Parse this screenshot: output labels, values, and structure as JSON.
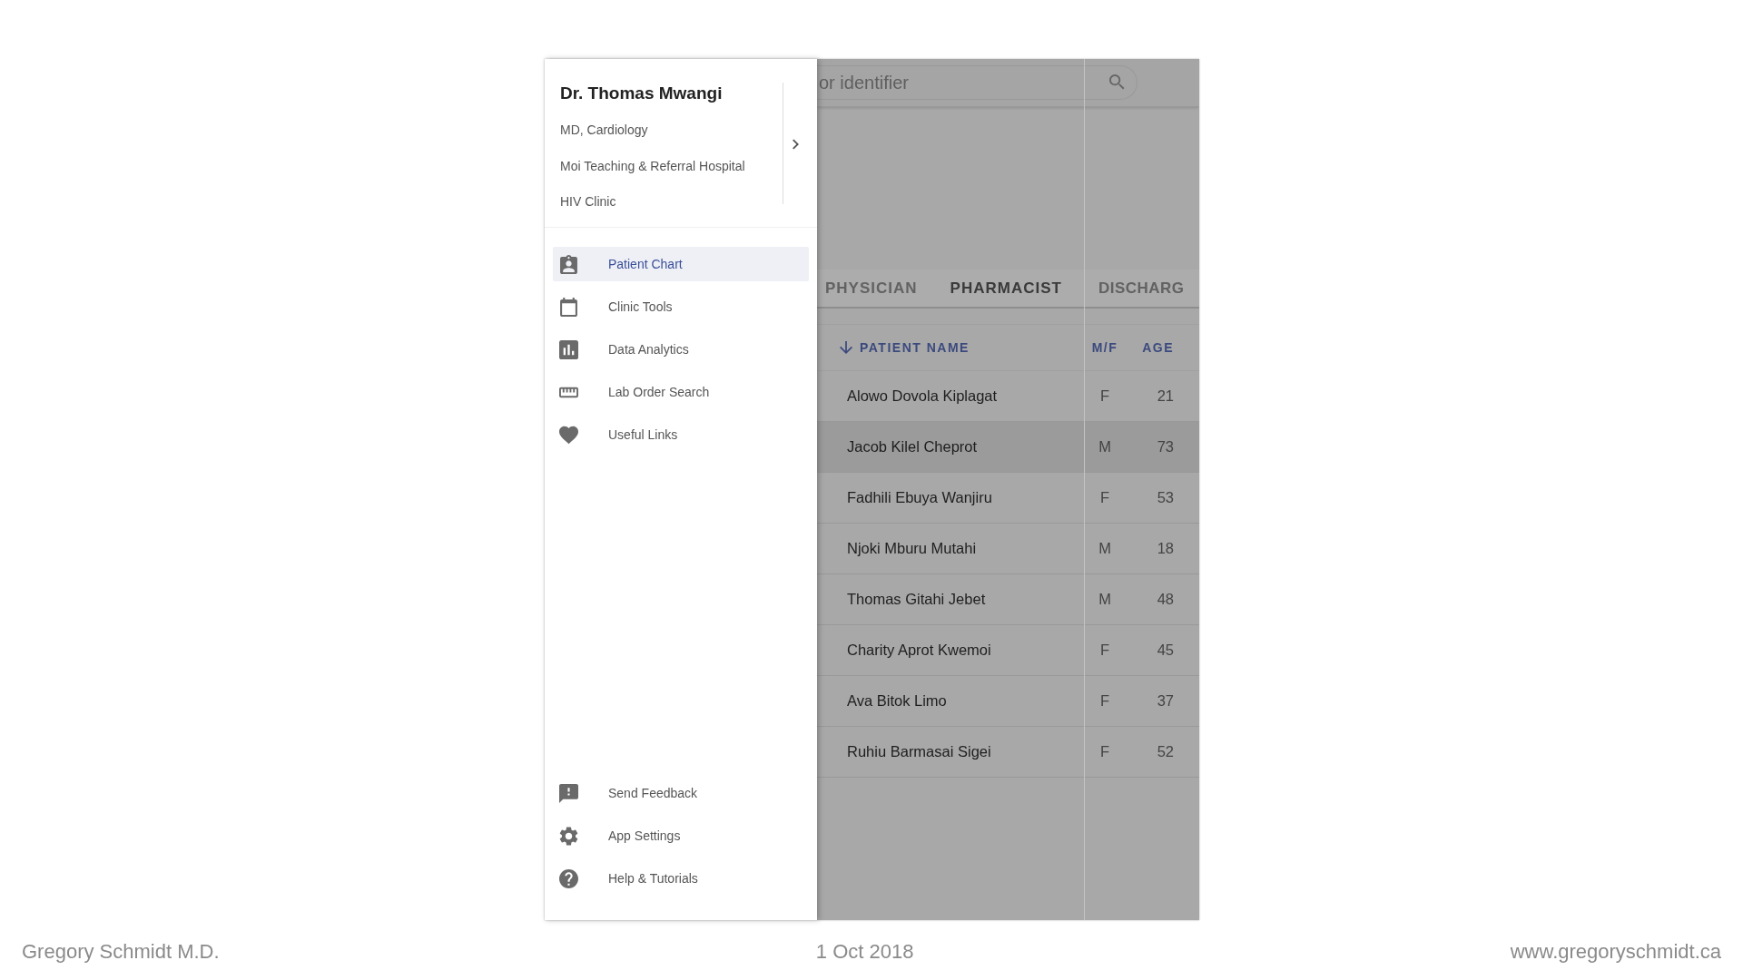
{
  "drawer": {
    "user": {
      "name": "Dr. Thomas Mwangi",
      "details": [
        "MD, Cardiology",
        "Moi Teaching & Referral Hospital",
        "HIV Clinic"
      ]
    },
    "top_items": [
      {
        "label": "Patient Chart",
        "selected": true
      },
      {
        "label": "Clinic Tools",
        "selected": false
      },
      {
        "label": "Data Analytics",
        "selected": false
      },
      {
        "label": "Lab Order Search",
        "selected": false
      },
      {
        "label": "Useful Links",
        "selected": false
      }
    ],
    "bottom_items": [
      {
        "label": "Send Feedback",
        "selected": false
      },
      {
        "label": "App Settings",
        "selected": false
      },
      {
        "label": "Help & Tutorials",
        "selected": false
      }
    ]
  },
  "search": {
    "placeholder": "or identifier"
  },
  "tabs": [
    {
      "label": "PHYSICIAN",
      "selected": false
    },
    {
      "label": "PHARMACIST",
      "selected": true
    },
    {
      "label": "DISCHARG",
      "selected": false
    }
  ],
  "table": {
    "columns": [
      "PATIENT NAME",
      "M/F",
      "AGE"
    ],
    "rows": [
      {
        "cells": [
          "Alowo Dovola Kiplagat",
          "F",
          "21"
        ],
        "selected": false
      },
      {
        "cells": [
          "Jacob Kilel Cheprot",
          "M",
          "73"
        ],
        "selected": true
      },
      {
        "cells": [
          "Fadhili Ebuya Wanjiru",
          "F",
          "53"
        ],
        "selected": false
      },
      {
        "cells": [
          "Njoki Mburu Mutahi",
          "M",
          "18"
        ],
        "selected": false
      },
      {
        "cells": [
          "Thomas Gitahi Jebet",
          "M",
          "48"
        ],
        "selected": false
      },
      {
        "cells": [
          "Charity Aprot Kwemoi",
          "F",
          "45"
        ],
        "selected": false
      },
      {
        "cells": [
          "Ava Bitok Limo",
          "F",
          "37"
        ],
        "selected": false
      },
      {
        "cells": [
          "Ruhiu Barmasai Sigei",
          "F",
          "52"
        ],
        "selected": false
      }
    ]
  },
  "footer": {
    "author": "Gregory Schmidt M.D.",
    "date": "1 Oct 2018",
    "website": "www.gregoryschmidt.ca"
  }
}
